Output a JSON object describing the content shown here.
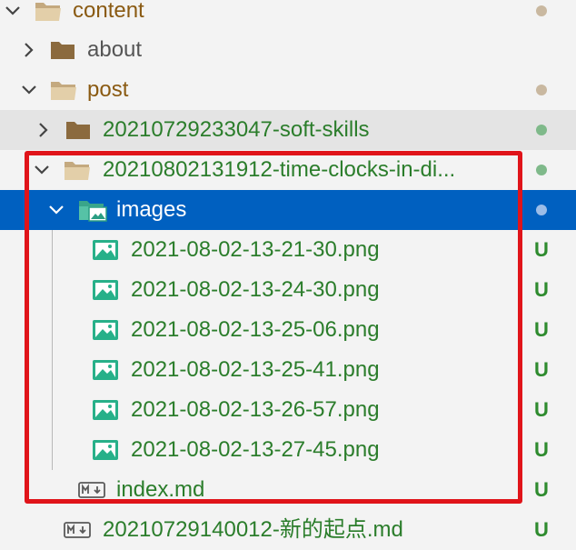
{
  "tree": {
    "content_label": "content",
    "about_label": "about",
    "post_label": "post",
    "soft_skills_label": "20210729233047-soft-skills",
    "time_clocks_label": "20210802131912-time-clocks-in-di...",
    "images_label": "images",
    "files": [
      {
        "name": "2021-08-02-13-21-30.png",
        "status": "U"
      },
      {
        "name": "2021-08-02-13-24-30.png",
        "status": "U"
      },
      {
        "name": "2021-08-02-13-25-06.png",
        "status": "U"
      },
      {
        "name": "2021-08-02-13-25-41.png",
        "status": "U"
      },
      {
        "name": "2021-08-02-13-26-57.png",
        "status": "U"
      },
      {
        "name": "2021-08-02-13-27-45.png",
        "status": "U"
      }
    ],
    "index_md": {
      "name": "index.md",
      "status": "U"
    },
    "new_start_md": {
      "name": "20210729140012-新的起点.md",
      "status": "U"
    }
  },
  "colors": {
    "selection": "#0060c0",
    "highlight_box": "#e0141a",
    "untracked_green": "#2b7d2b",
    "folder_brown": "#8a5a12"
  },
  "icons": {
    "folder": "folder-icon",
    "folder_open": "folder-open-icon",
    "image_folder": "image-folder-icon",
    "image_file": "image-file-icon",
    "markdown_file": "markdown-file-icon"
  }
}
